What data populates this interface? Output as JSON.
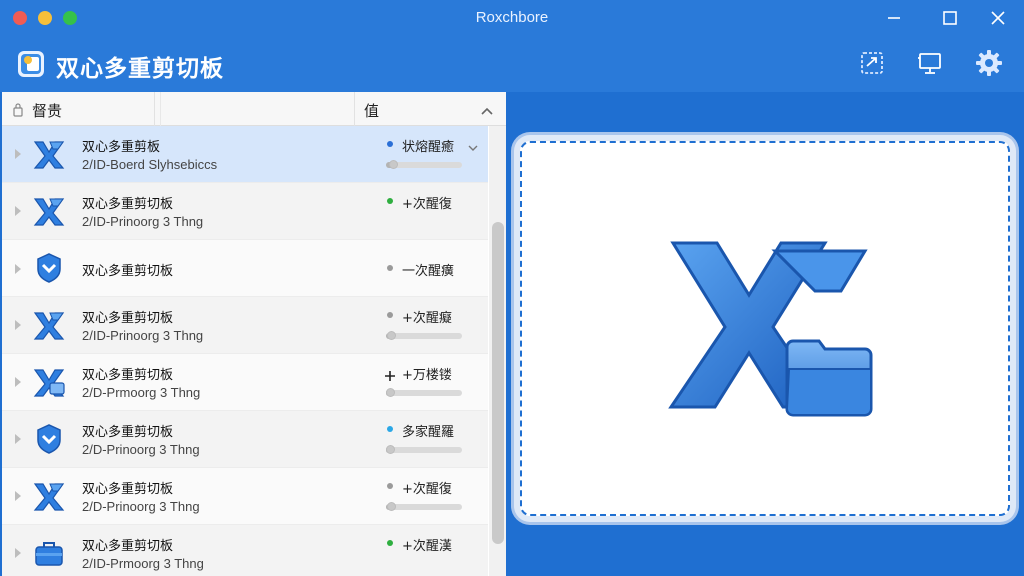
{
  "window": {
    "title": "Roxchbore",
    "controls": [
      "minimize-icon",
      "maximize-icon",
      "close-icon"
    ]
  },
  "app": {
    "title": "双心多重剪切板",
    "logo_icon": "clipboard-logo-icon"
  },
  "header_actions": [
    {
      "name": "paste-action-icon"
    },
    {
      "name": "monitor-icon"
    },
    {
      "name": "gear-icon"
    }
  ],
  "columns": {
    "name": "督贵",
    "value": "值"
  },
  "rows": [
    {
      "title": "双心多重剪板",
      "subtitle": "2/ID-Boerd Slyhsebiccs",
      "status": "状熔醒癒",
      "dot": "#2a6fd6",
      "selected": true,
      "progress": 0.1,
      "icon": "xx-logo-icon"
    },
    {
      "title": "双心多重剪切板",
      "subtitle": "2/ID-Prinoorg 3 Thng",
      "status": "+次醒復",
      "dot": "#2eae3f",
      "progress": null,
      "icon": "xx-logo-icon"
    },
    {
      "title": "双心多重剪切板",
      "subtitle": "",
      "status": "一次醒癀",
      "dot": "#9a9a9a",
      "progress": null,
      "icon": "shield-logo-icon"
    },
    {
      "title": "双心多重剪切板",
      "subtitle": "2/ID-Prinoorg 3 Thng",
      "status": "+次醒癡",
      "dot": "#9a9a9a",
      "progress": 0.08,
      "icon": "xx-logo-icon"
    },
    {
      "title": "双心多重剪切板",
      "subtitle": "2/D-Prmoorg 3 Thng",
      "status": "+万楼镂",
      "dot": "plus",
      "progress": 0.06,
      "icon": "xx-folder-icon"
    },
    {
      "title": "双心多重剪切板",
      "subtitle": "2/D-Prinoorg 3 Thng",
      "status": "多家醒羅",
      "dot": "#2aa7e6",
      "progress": 0.07,
      "icon": "shield-logo-icon"
    },
    {
      "title": "双心多重剪切板",
      "subtitle": "2/D-Prinoorg 3 Thng",
      "status": "+次醒復",
      "dot": "#9a9a9a",
      "progress": 0.08,
      "icon": "xx-logo-icon"
    },
    {
      "title": "双心多重剪切板",
      "subtitle": "2/ID-Prmoorg 3 Thng",
      "status": "+次醒漢",
      "dot": "#2eae3f",
      "progress": null,
      "icon": "briefcase-icon"
    }
  ],
  "preview": {
    "image": "xx-folder-logo-icon"
  },
  "colors": {
    "accent": "#1f6fd1",
    "selected_row": "#d6e6fb"
  }
}
